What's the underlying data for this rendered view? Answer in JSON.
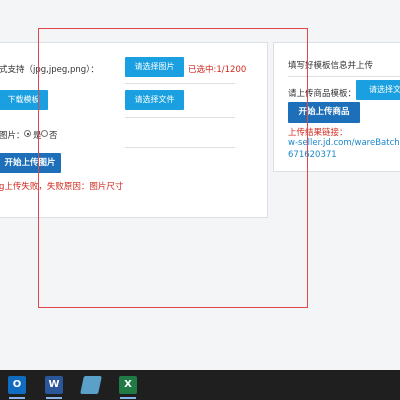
{
  "left_panel": {
    "format_label": "式支持（jpg,jpeg,png）：",
    "select_image_label": "请选择图片",
    "selected_count": "已选中:1/1200",
    "download_template_label": "下载模板",
    "select_file_label": "请选择文件",
    "image_option_label": "图片：",
    "radio_yes_label": "是",
    "radio_no_label": "否",
    "start_upload_images_label": "开始上传图片",
    "error_text": "g上传失败，失败原因：图片尺寸"
  },
  "right_panel": {
    "fill_template_title": "填写好模板信息并上传",
    "upload_product_template_label": "请上传商品模板：",
    "select_file_label": "请选择文",
    "start_upload_products_label": "开始上传商品",
    "result_link_label": "上传结果链接：",
    "result_link_url_line1": "w-seller.jd.com/wareBatchPubli",
    "result_link_url_line2": "671620371"
  },
  "taskbar": {
    "apps": [
      {
        "name": "outlook",
        "glyph": "O",
        "color": "#0f6cc0"
      },
      {
        "name": "word",
        "glyph": "W",
        "color": "#2b579a"
      },
      {
        "name": "app",
        "glyph": "",
        "color": "#5aa0c8"
      },
      {
        "name": "excel",
        "glyph": "X",
        "color": "#1f7a45"
      }
    ]
  },
  "colors": {
    "primary_button": "#1aa0e0",
    "dark_button": "#1c6fb8",
    "error": "#d0281e",
    "link": "#1a88cc",
    "overlay": "#e0474c"
  }
}
